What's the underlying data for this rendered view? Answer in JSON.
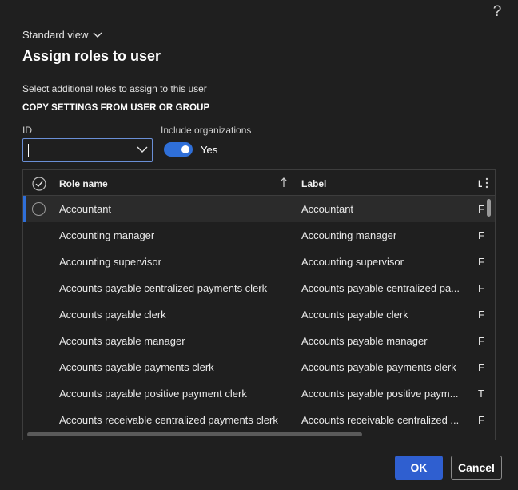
{
  "help": "?",
  "view": {
    "label": "Standard view"
  },
  "title": "Assign roles to user",
  "subtitle": "Select additional roles to assign to this user",
  "section_heading": "COPY SETTINGS FROM USER OR GROUP",
  "id_field": {
    "label": "ID",
    "value": ""
  },
  "include_orgs": {
    "label": "Include organizations",
    "state_text": "Yes",
    "on": true
  },
  "grid": {
    "columns": [
      "Role name",
      "Label",
      "L"
    ],
    "rows": [
      {
        "role": "Accountant",
        "label": "Accountant",
        "c3": "F"
      },
      {
        "role": "Accounting manager",
        "label": "Accounting manager",
        "c3": "F"
      },
      {
        "role": "Accounting supervisor",
        "label": "Accounting supervisor",
        "c3": "F"
      },
      {
        "role": "Accounts payable centralized payments clerk",
        "label": "Accounts payable centralized pa...",
        "c3": "F"
      },
      {
        "role": "Accounts payable clerk",
        "label": "Accounts payable clerk",
        "c3": "F"
      },
      {
        "role": "Accounts payable manager",
        "label": "Accounts payable manager",
        "c3": "F"
      },
      {
        "role": "Accounts payable payments clerk",
        "label": "Accounts payable payments clerk",
        "c3": "F"
      },
      {
        "role": "Accounts payable positive payment clerk",
        "label": "Accounts payable positive paym...",
        "c3": "T"
      },
      {
        "role": "Accounts receivable centralized payments clerk",
        "label": "Accounts receivable centralized ...",
        "c3": "F"
      }
    ]
  },
  "buttons": {
    "ok": "OK",
    "cancel": "Cancel"
  },
  "colors": {
    "accent": "#2f6fd8",
    "background": "#1f1f1f"
  }
}
